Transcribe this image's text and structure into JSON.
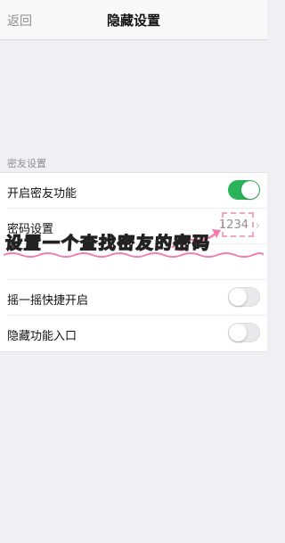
{
  "navbar": {
    "back_label": "返回",
    "title": "隐藏设置"
  },
  "section": {
    "header": "密友设置"
  },
  "rows": {
    "enable": {
      "label": "开启密友功能",
      "toggle_on": true
    },
    "password": {
      "label": "密码设置",
      "value": "1234"
    },
    "shake": {
      "label": "摇一摇快捷开启",
      "toggle_on": false
    },
    "hidden_entry": {
      "label": "隐藏功能入口",
      "toggle_on": false
    }
  },
  "annotation": {
    "text": "设置一个查找密友的密码"
  },
  "colors": {
    "toggle_on": "#2bb35a",
    "annotation_pink": "#f07fb0"
  }
}
